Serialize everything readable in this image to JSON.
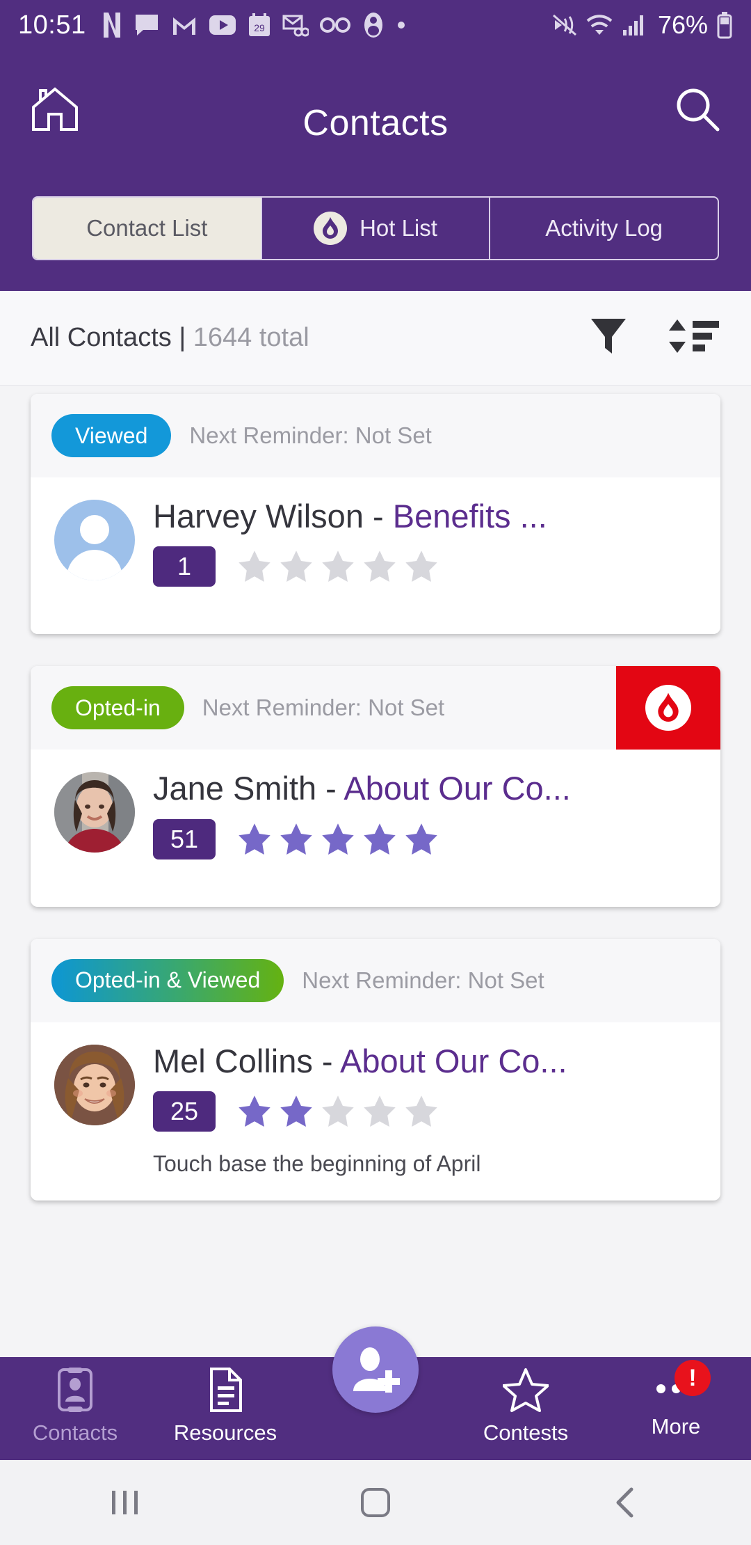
{
  "status_bar": {
    "time": "10:51",
    "battery_percent": "76%",
    "left_icons": [
      "netflix-icon",
      "messages-icon",
      "gmail-icon",
      "youtube-icon",
      "calendar-29-icon",
      "email-voicemail-icon",
      "voicemail-icon",
      "account-icon",
      "dot-icon"
    ],
    "right_icons": [
      "vibrate-icon",
      "wifi-icon",
      "signal-icon",
      "battery-icon"
    ]
  },
  "header": {
    "title": "Contacts",
    "home_icon": "home-icon",
    "search_icon": "search-icon"
  },
  "tabs": [
    {
      "label": "Contact List",
      "active": true,
      "icon": null
    },
    {
      "label": "Hot List",
      "active": false,
      "icon": "flame-icon"
    },
    {
      "label": "Activity Log",
      "active": false,
      "icon": null
    }
  ],
  "summary": {
    "scope": "All Contacts",
    "separator": "|",
    "total": "1644 total",
    "filter_icon": "filter-funnel-icon",
    "sort_icon": "sort-icon"
  },
  "contacts": [
    {
      "status_label": "Viewed",
      "status_color": "#1398d9",
      "status_gradient": null,
      "reminder": "Next Reminder: Not Set",
      "hot": false,
      "name": "Harvey Wilson",
      "dash": " - ",
      "topic": "Benefits ...",
      "count": "1",
      "stars_filled": 0,
      "stars_total": 5,
      "note": null,
      "avatar_type": "placeholder"
    },
    {
      "status_label": "Opted-in",
      "status_color": "#68b010",
      "status_gradient": null,
      "reminder": "Next Reminder: Not Set",
      "hot": true,
      "name": "Jane Smith",
      "dash": " - ",
      "topic": "About Our Co...",
      "count": "51",
      "stars_filled": 5,
      "stars_total": 5,
      "note": null,
      "avatar_type": "photo-jane"
    },
    {
      "status_label": "Opted-in & Viewed",
      "status_color": "#1398d9",
      "status_gradient": "linear-gradient(90deg,#0d96d4 0%,#3aa86e 55%,#65b211 100%)",
      "reminder": "Next Reminder: Not Set",
      "hot": false,
      "name": "Mel Collins",
      "dash": " - ",
      "topic": "About Our Co...",
      "count": "25",
      "stars_filled": 2,
      "stars_total": 5,
      "note": "Touch base the beginning of April",
      "avatar_type": "photo-mel"
    }
  ],
  "bottom_nav": {
    "items": [
      {
        "label": "Contacts",
        "icon": "contact-card-icon",
        "active": true
      },
      {
        "label": "Resources",
        "icon": "document-icon",
        "active": false
      },
      {
        "label": "Contests",
        "icon": "star-outline-icon",
        "active": false
      },
      {
        "label": "More",
        "icon": "more-dots-icon",
        "active": false,
        "alert": "!"
      }
    ],
    "fab": {
      "icon": "add-person-icon"
    }
  },
  "android_nav": {
    "recents": "recents-icon",
    "home": "home-square-icon",
    "back": "back-chevron-icon"
  },
  "colors": {
    "brand_purple": "#512e80",
    "accent_purple": "#5b2d8e",
    "star_filled": "#7668c8",
    "star_empty": "#d7d7dc",
    "hot_red": "#e30613"
  }
}
